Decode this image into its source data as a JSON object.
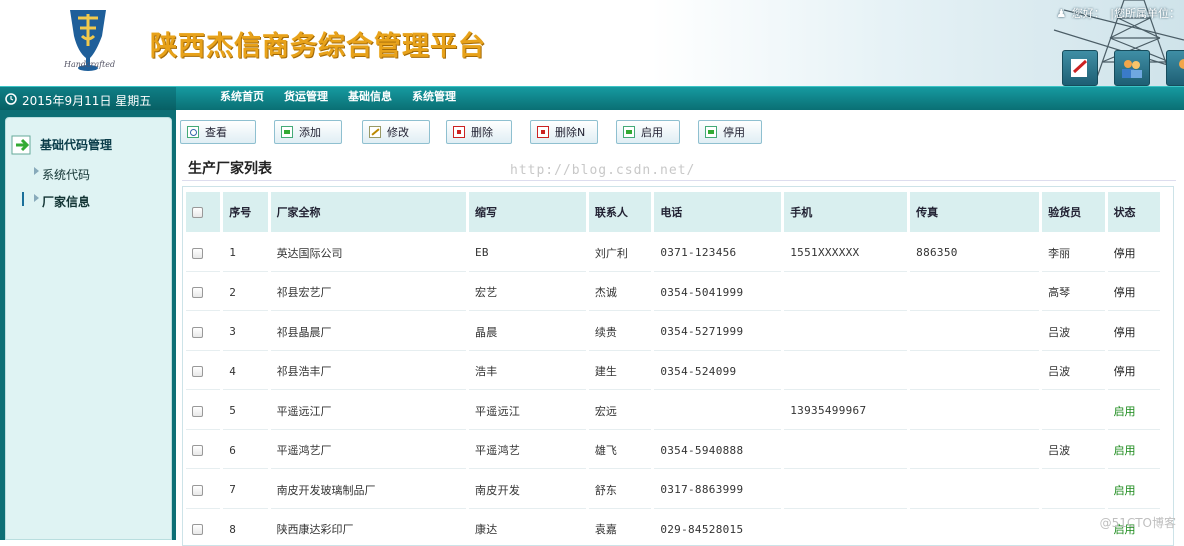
{
  "header": {
    "app_title": "陕西杰信商务综合管理平台",
    "logo_script": "Handcrafted",
    "greeting": "您好：",
    "unit_label": "|您所属单位："
  },
  "header_buttons": [
    {
      "icon": "edit-document-icon"
    },
    {
      "icon": "users-icon"
    },
    {
      "icon": "user-icon"
    }
  ],
  "navbar": {
    "date": "2015年9月11日 星期五",
    "links": [
      "系统首页",
      "货运管理",
      "基础信息",
      "系统管理"
    ]
  },
  "sidebar": {
    "group_label": "基础代码管理",
    "items": [
      {
        "label": "系统代码"
      },
      {
        "label": "厂家信息"
      }
    ]
  },
  "toolbar": {
    "buttons": [
      {
        "label": "查看",
        "icon": "view-icon"
      },
      {
        "label": "添加",
        "icon": "add-icon"
      },
      {
        "label": "修改",
        "icon": "edit-icon"
      },
      {
        "label": "删除",
        "icon": "delete-icon"
      },
      {
        "label": "删除N",
        "icon": "delete-multiple-icon"
      },
      {
        "label": "启用",
        "icon": "enable-icon"
      },
      {
        "label": "停用",
        "icon": "disable-icon"
      }
    ]
  },
  "list": {
    "title": "生产厂家列表",
    "columns": [
      "序号",
      "厂家全称",
      "缩写",
      "联系人",
      "电话",
      "手机",
      "传真",
      "验货员",
      "状态"
    ],
    "rows": [
      [
        "1",
        "英达国际公司",
        "EB",
        "刘广利",
        "0371-123456",
        "1551XXXXXX",
        "886350",
        "李丽",
        "停用"
      ],
      [
        "2",
        "祁县宏艺厂",
        "宏艺",
        "杰诚",
        "0354-5041999",
        "",
        "",
        "高琴",
        "停用"
      ],
      [
        "3",
        "祁县晶晨厂",
        "晶晨",
        "续贵",
        "0354-5271999",
        "",
        "",
        "吕波",
        "停用"
      ],
      [
        "4",
        "祁县浩丰厂",
        "浩丰",
        "建生",
        "0354-524099",
        "",
        "",
        "吕波",
        "停用"
      ],
      [
        "5",
        "平遥远江厂",
        "平遥远江",
        "宏远",
        "",
        "13935499967",
        "",
        "",
        "启用"
      ],
      [
        "6",
        "平遥鸿艺厂",
        "平遥鸿艺",
        "雄飞",
        "0354-5940888",
        "",
        "",
        "吕波",
        "启用"
      ],
      [
        "7",
        "南皮开发玻璃制品厂",
        "南皮开发",
        "舒东",
        "0317-8863999",
        "",
        "",
        "",
        "启用"
      ],
      [
        "8",
        "陕西康达彩印厂",
        "康达",
        "袁嘉",
        "029-84528015",
        "",
        "",
        "",
        "启用"
      ]
    ]
  },
  "status_colors": {
    "停用": "#222222",
    "启用": "#1a8a1a"
  },
  "watermark": "http://blog.csdn.net/",
  "corner_watermark": "@51CTO博客"
}
